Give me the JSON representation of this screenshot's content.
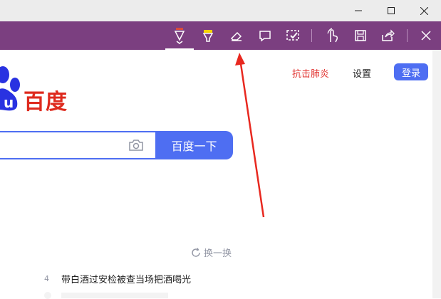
{
  "window": {
    "controls": [
      "minimize",
      "maximize",
      "close"
    ]
  },
  "ink_toolbar": {
    "tools": [
      {
        "name": "ballpoint-pen-icon",
        "active": true
      },
      {
        "name": "highlighter-icon",
        "active": false
      },
      {
        "name": "eraser-icon",
        "active": false
      },
      {
        "name": "add-note-icon",
        "active": false
      },
      {
        "name": "clip-icon",
        "active": false
      },
      {
        "name": "touch-writing-icon",
        "active": false
      },
      {
        "name": "save-icon",
        "active": false
      },
      {
        "name": "share-icon",
        "active": false
      },
      {
        "name": "exit-icon",
        "active": false
      }
    ],
    "colors": {
      "toolbar": "#7b3f80",
      "pen": "#d94a3b",
      "highlighter": "#f5d400"
    }
  },
  "page": {
    "top_links": {
      "news": "抗击肺炎",
      "settings": "设置",
      "login": "登录"
    },
    "logo": {
      "text": "百度"
    },
    "search": {
      "button_label": "百度一下"
    },
    "refresh_label": "换一换",
    "hot_list": [
      {
        "rank": "4",
        "title": "带白酒过安检被查当场把酒喝光"
      }
    ],
    "colors": {
      "accent": "#4e6ef2",
      "brand_red": "#de2a1e",
      "link_red": "#e1312e",
      "annotation_arrow": "#e8281f"
    }
  }
}
